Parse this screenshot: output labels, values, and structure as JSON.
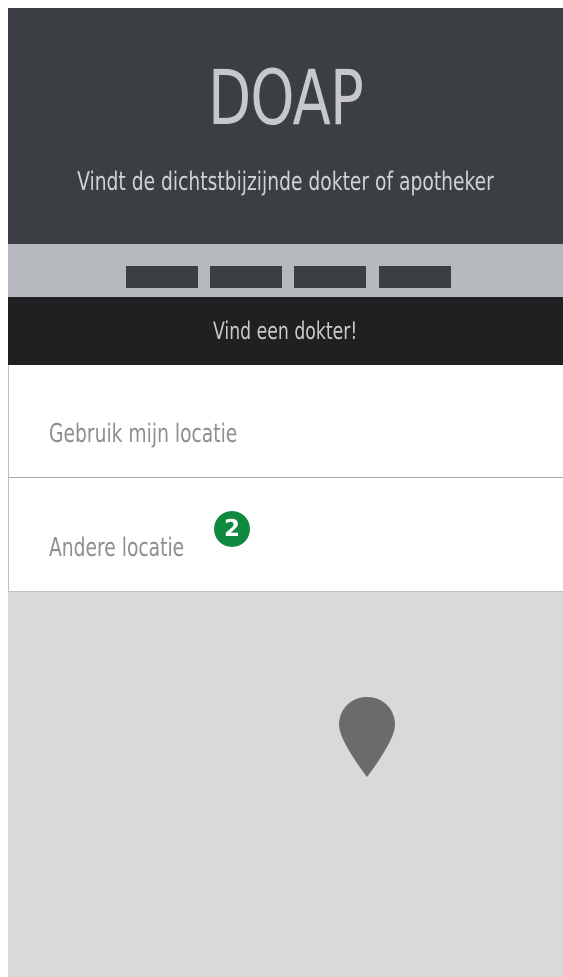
{
  "header": {
    "title": "DOAP",
    "subtitle": "Vindt de dichtstbijzijnde dokter of apotheker"
  },
  "tabs": [
    "",
    "",
    "",
    ""
  ],
  "cta": {
    "label": "Vind een dokter!"
  },
  "options": [
    {
      "label": "Gebruik mijn locatie"
    },
    {
      "label": "Andere locatie",
      "badge": "2"
    }
  ],
  "map": {
    "marker_icon": "map-pin-icon"
  },
  "colors": {
    "header_bg": "#3b3e42",
    "tabbar_bg": "#b6b9be",
    "cta_bg": "#1e2022",
    "badge_bg": "#0d8a3f",
    "map_bg": "#d9d9d9",
    "pin": "#6b6b6b"
  }
}
